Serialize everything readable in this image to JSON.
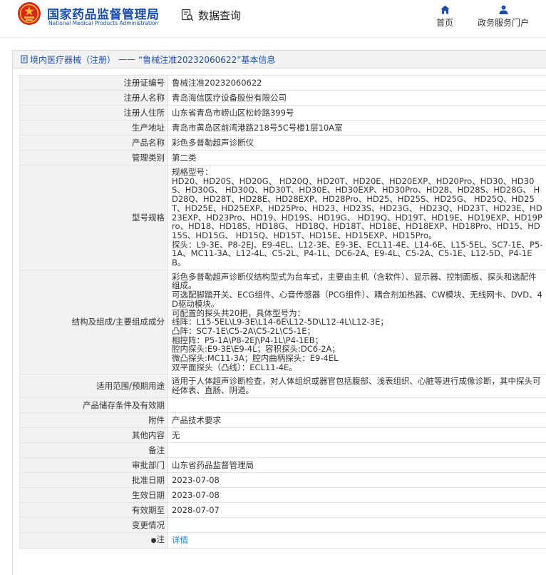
{
  "header": {
    "brand_cn": "国家药品监督管理局",
    "brand_en": "National Medical Products Administration",
    "query_label": "数据查询",
    "nav": [
      {
        "label": "首页",
        "icon": "home-icon"
      },
      {
        "label": "政务服务门户",
        "icon": "user-icon"
      }
    ]
  },
  "breadcrumb": {
    "section": "境内医疗器械（注册）",
    "separator": "——",
    "title": "“鲁械注准20232060622”基本信息"
  },
  "fields": {
    "reg_no": {
      "label": "注册证编号",
      "value": "鲁械注准20232060622"
    },
    "registrant": {
      "label": "注册人名称",
      "value": "青岛海信医疗设备股份有限公司"
    },
    "registrant_addr": {
      "label": "注册人住所",
      "value": "山东省青岛市崂山区松岭路399号"
    },
    "prod_addr": {
      "label": "生产地址",
      "value": "青岛市黄岛区前湾港路218号5C号楼1层10A室"
    },
    "product_name": {
      "label": "产品名称",
      "value": "彩色多普勒超声诊断仪"
    },
    "category": {
      "label": "管理类别",
      "value": "第二类"
    },
    "model": {
      "label": "型号规格",
      "value": "规格型号：\nHD20、HD20S、HD20G、 HD20Q、HD20T、HD20E、HD20EXP、HD20Pro、HD30、HD30S、HD30G、 HD30Q、HD30T、HD30E、HD30EXP、HD30Pro、HD28、HD28S、HD28G、 HD28Q、HD28T、HD28E、HD28EXP、HD28Pro、HD25、HD25S、HD25G、 HD25Q、HD25T、HD25E、HD25EXP、HD25Pro、HD23、HD23S、HD23G、 HD23Q、HD23T、HD23E、HD23EXP、HD23Pro、HD19、HD19S、HD19G、 HD19Q、HD19T、HD19E、HD19EXP、HD19Pro、HD18、HD18S、HD18G、 HD18Q、HD18T、HD18E、HD18EXP、HD18Pro、HD15、HD15S、HD15G、 HD15Q、HD15T、HD15E、HD15EXP、HD15Pro。\n探头：L9-3E、P8-2EJ、E9-4EL、L12-3E、E9-3E、ECL11-4E、L14-6E、L15-5EL、SC7-1E、P5-1A、MC11-3A、L12-4L、C5-2L、P4-1L、DC6-2A、E9-4L、C5-2A、C5-1E、L12-5D、P4-1EB。"
    },
    "structure": {
      "label": "结构及组成/主要组成成分",
      "value": "彩色多普勒超声诊断仪结构型式为台车式，主要由主机（含软件）、显示器、控制面板、探头和选配件组成。\n可选配脚踏开关、ECG组件、心音传感器（PCG组件）、耦合剂加热器、CW模块、无线网卡、DVD、4D驱动模块。\n可配置的探头共20把，具体型号为：\n线阵：L15-5EL\\L9-3E\\L14-6E\\L12-5D\\L12-4L\\L12-3E；\n凸阵：SC7-1E\\C5-2A\\C5-2L\\C5-1E；\n相控阵：P5-1A\\P8-2EJ\\P4-1L\\P4-1EB；\n腔内探头:E9-3E\\E9-4L；容积探头:DC6-2A；\n微凸探头:MC11-3A；腔内曲柄探头：E9-4EL\n双平面探头（凸线）：ECL11-4E。"
    },
    "scope": {
      "label": "适用范围/预期用途",
      "value": "适用于人体超声诊断检查，对人体组织或器官包括腹部、浅表组织、心脏等进行成像诊断，其中探头可经体表、直肠、阴道。"
    },
    "storage": {
      "label": "产品储存条件及有效期",
      "value": ""
    },
    "attachment": {
      "label": "附件",
      "value": "产品技术要求"
    },
    "other": {
      "label": "其他内容",
      "value": "无"
    },
    "remark": {
      "label": "备注",
      "value": ""
    },
    "dept": {
      "label": "审批部门",
      "value": "山东省药品监督管理局"
    },
    "approve_date": {
      "label": "批准日期",
      "value": "2023-07-08"
    },
    "effective_date": {
      "label": "生效日期",
      "value": "2023-07-08"
    },
    "expire_date": {
      "label": "有效期至",
      "value": "2028-07-07"
    },
    "change": {
      "label": "变更情况",
      "value": ""
    },
    "note": {
      "label": "注",
      "value": "详情"
    }
  }
}
